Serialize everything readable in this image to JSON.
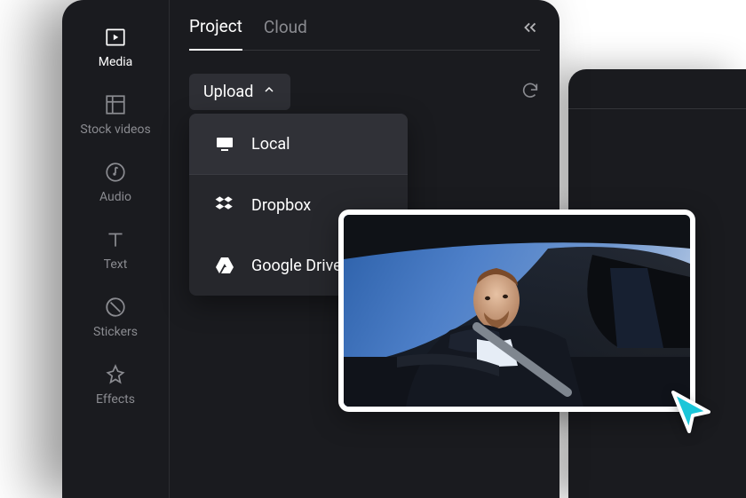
{
  "sidebar": {
    "items": [
      {
        "label": "Media",
        "icon": "media-icon",
        "active": true
      },
      {
        "label": "Stock videos",
        "icon": "stock-videos-icon",
        "active": false
      },
      {
        "label": "Audio",
        "icon": "audio-icon",
        "active": false
      },
      {
        "label": "Text",
        "icon": "text-icon",
        "active": false
      },
      {
        "label": "Stickers",
        "icon": "stickers-icon",
        "active": false
      },
      {
        "label": "Effects",
        "icon": "effects-icon",
        "active": false
      }
    ]
  },
  "tabs": {
    "items": [
      {
        "label": "Project",
        "active": true
      },
      {
        "label": "Cloud",
        "active": false
      }
    ]
  },
  "upload": {
    "label": "Upload"
  },
  "dropdown": {
    "items": [
      {
        "label": "Local",
        "icon": "monitor-icon"
      },
      {
        "label": "Dropbox",
        "icon": "dropbox-icon"
      },
      {
        "label": "Google Drive",
        "icon": "google-drive-icon"
      }
    ]
  },
  "thumbnail": {
    "description": "Man in leather jacket sitting in car, looking out window"
  },
  "colors": {
    "background": "#1a1b1f",
    "panel": "#26272c",
    "button": "#2e2f35",
    "text_primary": "#ffffff",
    "text_secondary": "#8a8b90",
    "border": "#343539",
    "accent_cursor": "#1bc6d9"
  }
}
